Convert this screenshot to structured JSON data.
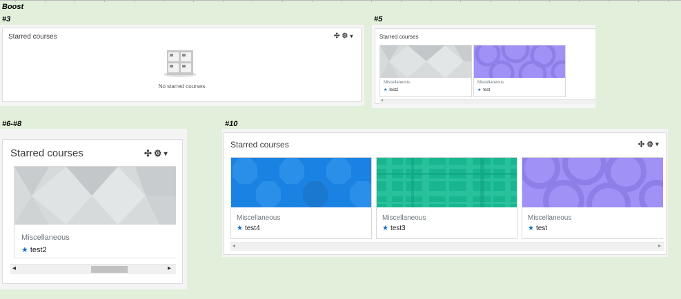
{
  "labels": {
    "boost": "Boost",
    "s3": "#3",
    "s5": "#5",
    "s68": "#6-#8",
    "s10": "#10"
  },
  "block": {
    "title": "Starred courses",
    "move_icon": "✣",
    "gear_icon": "⚙",
    "caret_icon": "▾",
    "empty_text": "No starred courses"
  },
  "courses": {
    "test2": {
      "category": "Miscellaneous",
      "name": "test2"
    },
    "test": {
      "category": "Miscellaneous",
      "name": "test"
    },
    "test4": {
      "category": "Miscellaneous",
      "name": "test4"
    },
    "test3": {
      "category": "Miscellaneous",
      "name": "test3"
    }
  },
  "colors": {
    "background": "#e2efda",
    "star": "#0f6cbf",
    "gray_pattern": "#d7dadb",
    "purple_pattern": "#9f91f5",
    "blue_pattern": "#1a82e2",
    "green_pattern": "#18b690"
  },
  "icons": {
    "star": "★",
    "left": "◂",
    "right": "▸"
  }
}
